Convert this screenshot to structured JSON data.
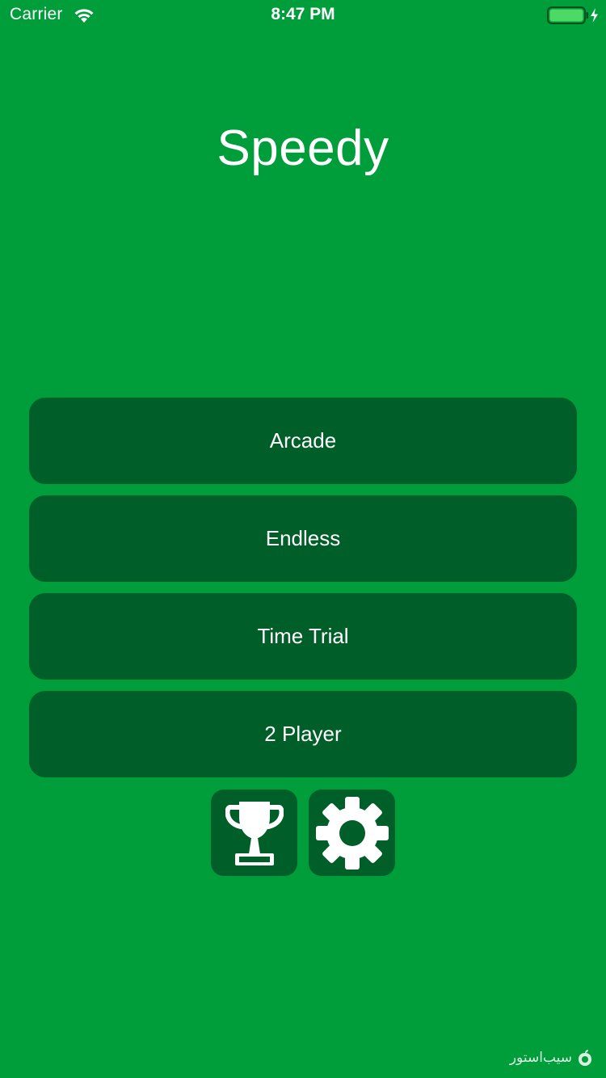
{
  "status_bar": {
    "carrier": "Carrier",
    "time": "8:47 PM",
    "battery_icon": "battery-charging-icon",
    "wifi_icon": "wifi-icon"
  },
  "app": {
    "title": "Speedy"
  },
  "menu": {
    "buttons": [
      {
        "label": "Arcade"
      },
      {
        "label": "Endless"
      },
      {
        "label": "Time Trial"
      },
      {
        "label": "2 Player"
      }
    ]
  },
  "icon_buttons": {
    "leaderboard": "trophy-icon",
    "settings": "gear-icon"
  },
  "watermark": {
    "text": "سیب‌استور"
  },
  "colors": {
    "background": "#009d3b",
    "button": "#005f28",
    "text": "#ffffff",
    "battery_fill": "#4cd964"
  }
}
